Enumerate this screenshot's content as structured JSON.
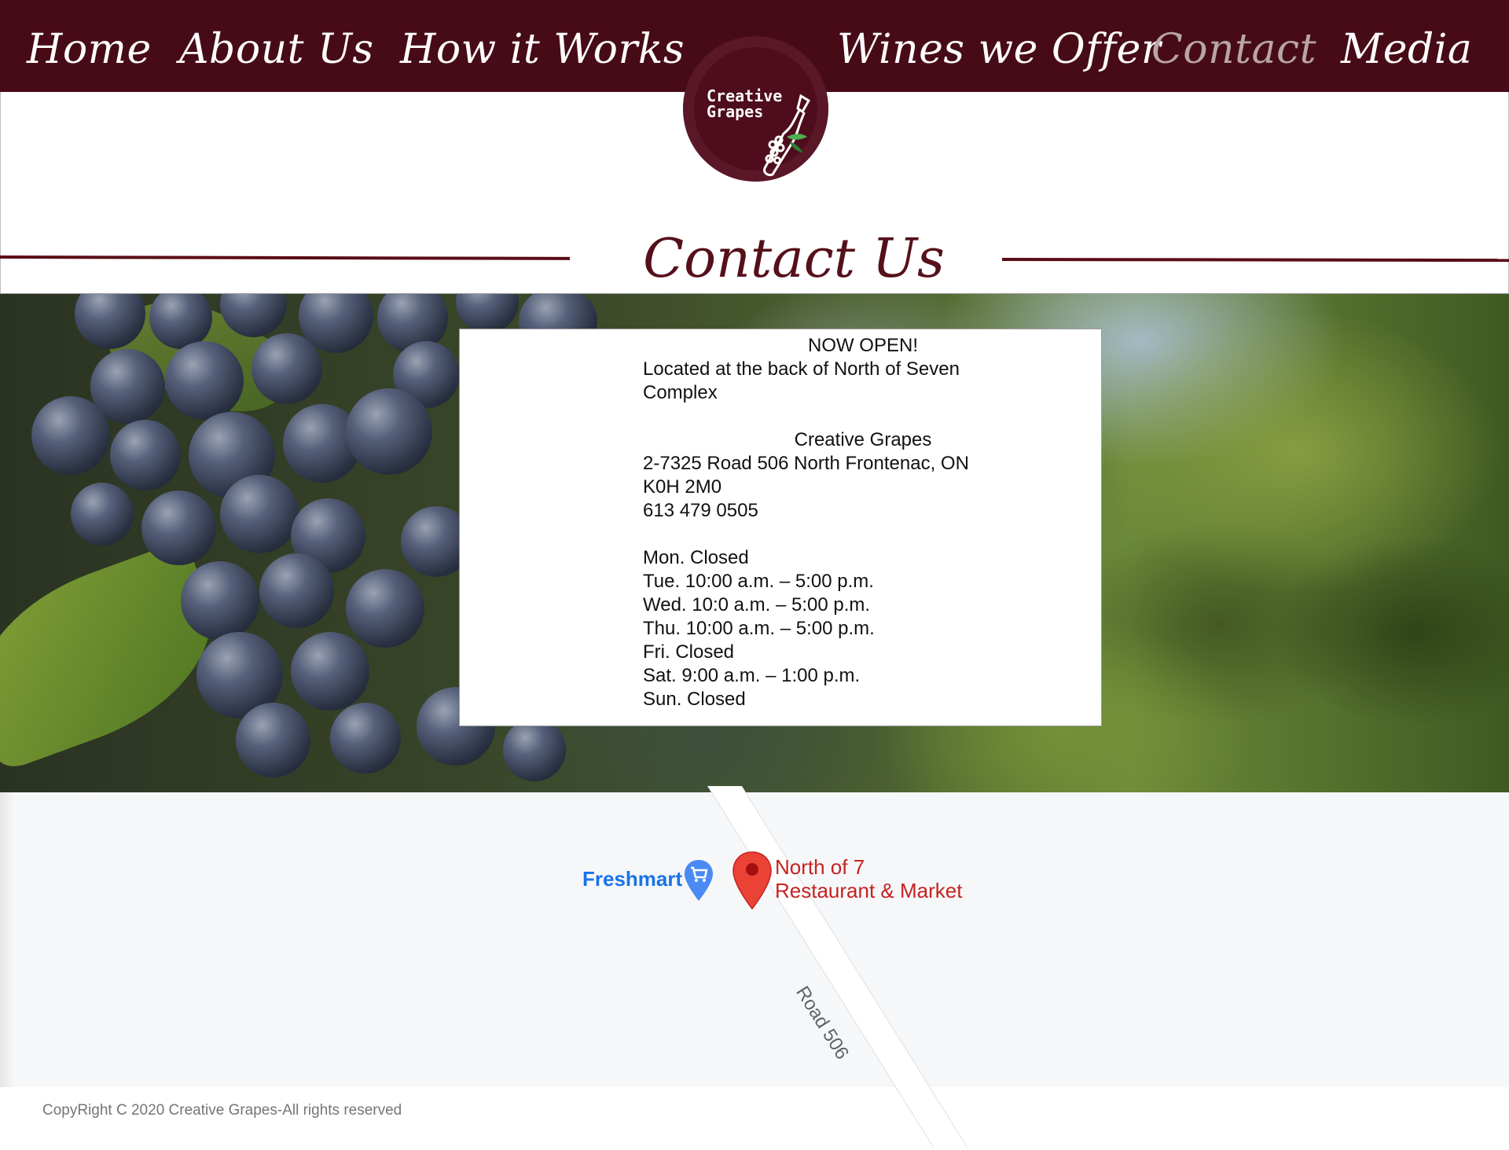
{
  "nav": {
    "items": [
      {
        "label": "Home"
      },
      {
        "label": "About Us"
      },
      {
        "label": "How it Works"
      },
      {
        "label": "Wines we Offer"
      },
      {
        "label": "Contact",
        "active": true
      },
      {
        "label": "Media"
      }
    ]
  },
  "logo": {
    "line1": "Creative",
    "line2": "Grapes",
    "icon": "wine-bottle-grapes-icon"
  },
  "page": {
    "title": "Contact Us"
  },
  "info": {
    "headline": "NOW OPEN!",
    "location_line1": "Located at the back of North of Seven",
    "location_line2": "Complex",
    "business_name": "Creative Grapes",
    "address_line1": "2-7325 Road 506 North Frontenac, ON",
    "postal_code": "K0H 2M0",
    "phone": "613 479 0505",
    "hours": [
      "Mon. Closed",
      "Tue. 10:00 a.m. – 5:00 p.m.",
      "Wed. 10:0 a.m. – 5:00 p.m.",
      "Thu. 10:00 a.m. – 5:00 p.m.",
      "Fri. Closed",
      "Sat. 9:00 a.m. – 1:00 p.m.",
      "Sun. Closed"
    ]
  },
  "map": {
    "freshmart": "Freshmart",
    "place_line1": "North of 7",
    "place_line2": "Restaurant & Market",
    "road": "Road 506"
  },
  "footer": {
    "copyright": "CopyRight C 2020 Creative Grapes-All rights reserved"
  },
  "colors": {
    "nav_bg": "#470b17",
    "accent": "#55101a",
    "map_place": "#c5221f",
    "map_link": "#1a73e8"
  }
}
